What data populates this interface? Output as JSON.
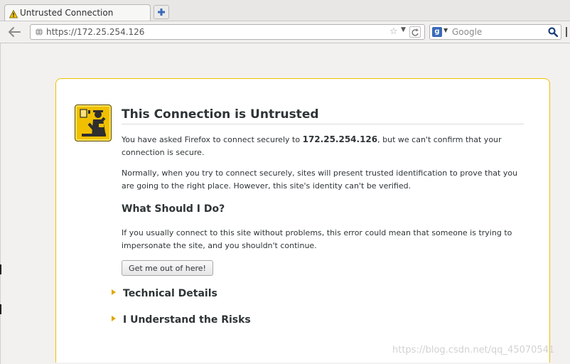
{
  "tab": {
    "title": "Untrusted Connection"
  },
  "navbar": {
    "url": "https://172.25.254.126",
    "search_placeholder": "Google"
  },
  "error_page": {
    "title": "This Connection is Untrusted",
    "intro_prefix": "You have asked Firefox to connect securely to ",
    "intro_host": "172.25.254.126",
    "intro_suffix": ", but we can't confirm that your connection is secure.",
    "explanation": "Normally, when you try to connect securely, sites will present trusted identification to prove that you are going to the right place. However, this site's identity can't be verified.",
    "what_to_do_heading": "What Should I Do?",
    "what_to_do_text": "If you usually connect to this site without problems, this error could mean that someone is trying to impersonate the site, and you shouldn't continue.",
    "get_out_button": "Get me out of here!",
    "technical_details": "Technical Details",
    "understand_risks": "I Understand the Risks"
  },
  "watermark": "https://blog.csdn.net/qq_45070541",
  "colors": {
    "accent_yellow": "#f0c000",
    "panel_border": "#f0c000",
    "text": "#2e3436",
    "search_engine_blue": "#3a6ab8"
  },
  "icons": {
    "tab_status": "warning-triangle-icon",
    "new_tab": "plus-icon",
    "back": "back-arrow-icon",
    "site_identity": "globe-icon",
    "bookmark": "star-icon",
    "history_dropdown": "chevron-down-icon",
    "reload": "reload-icon",
    "search_engine": "google-icon",
    "search": "magnifier-icon",
    "error_badge": "security-guard-icon",
    "expander": "triangle-right-icon"
  }
}
